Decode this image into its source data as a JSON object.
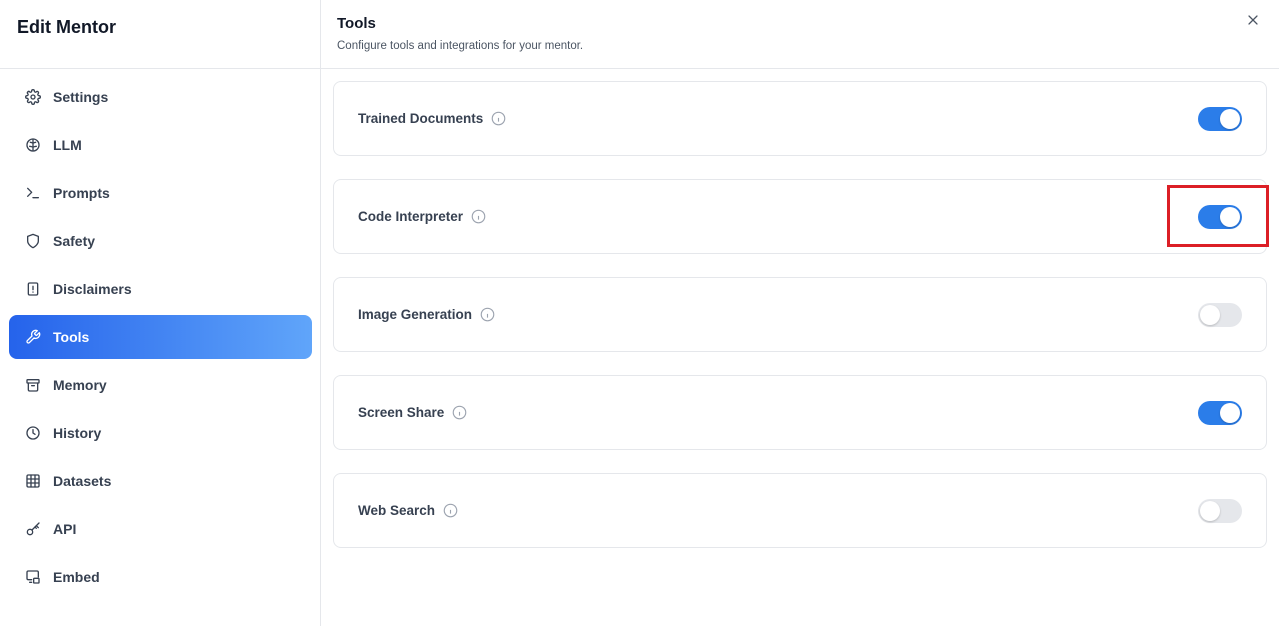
{
  "sidebar": {
    "title": "Edit Mentor",
    "items": [
      {
        "label": "Settings",
        "icon": "gear-icon",
        "active": false
      },
      {
        "label": "LLM",
        "icon": "brain-icon",
        "active": false
      },
      {
        "label": "Prompts",
        "icon": "terminal-icon",
        "active": false
      },
      {
        "label": "Safety",
        "icon": "shield-icon",
        "active": false
      },
      {
        "label": "Disclaimers",
        "icon": "alert-file-icon",
        "active": false
      },
      {
        "label": "Tools",
        "icon": "wrench-icon",
        "active": true
      },
      {
        "label": "Memory",
        "icon": "archive-icon",
        "active": false
      },
      {
        "label": "History",
        "icon": "clock-icon",
        "active": false
      },
      {
        "label": "Datasets",
        "icon": "grid-icon",
        "active": false
      },
      {
        "label": "API",
        "icon": "key-icon",
        "active": false
      },
      {
        "label": "Embed",
        "icon": "embed-icon",
        "active": false
      }
    ]
  },
  "main": {
    "title": "Tools",
    "subtitle": "Configure tools and integrations for your mentor.",
    "tools": [
      {
        "name": "Trained Documents",
        "enabled": true
      },
      {
        "name": "Code Interpreter",
        "enabled": true
      },
      {
        "name": "Image Generation",
        "enabled": false
      },
      {
        "name": "Screen Share",
        "enabled": true
      },
      {
        "name": "Web Search",
        "enabled": false
      }
    ]
  },
  "colors": {
    "accent": "#2b7de9",
    "active_nav_start": "#2563eb",
    "active_nav_end": "#60a5fa",
    "highlight": "#dc1f26"
  }
}
